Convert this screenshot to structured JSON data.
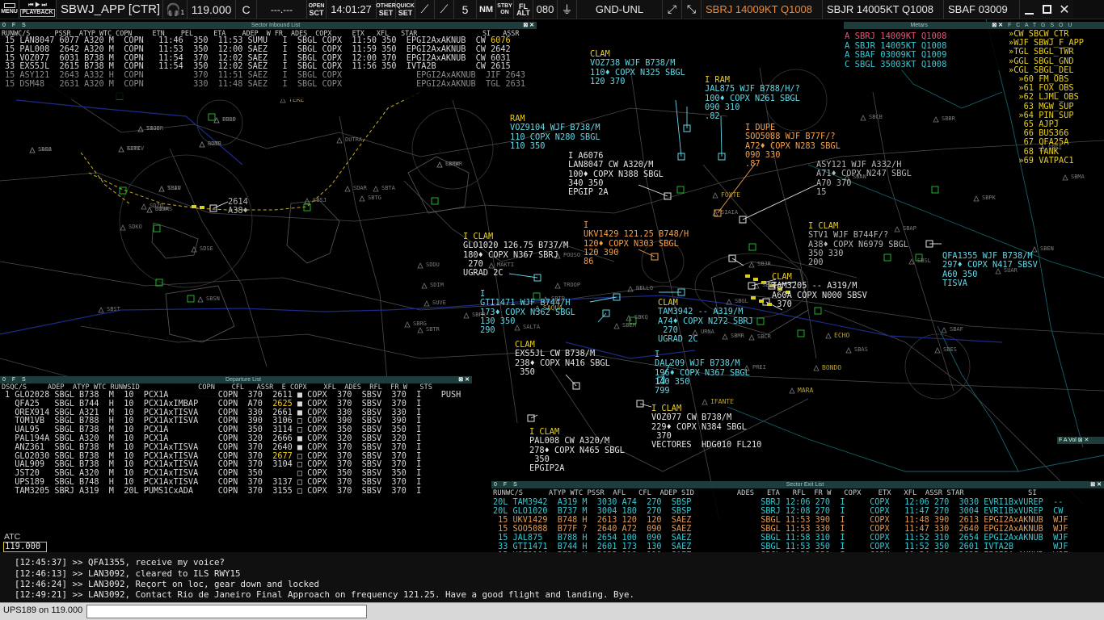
{
  "topbar": {
    "menu": "MENU",
    "playback": "PLAYBACK",
    "station": "SBWJ_APP [CTR]",
    "headset_sub": "1",
    "frequency": "119.000",
    "freq_type": "C",
    "freq_secondary": "---.---",
    "open_l1": "OPEN",
    "open_l2": "SCT",
    "time": "14:01:27",
    "other_l1": "OTHER",
    "other_l2": "SET",
    "quick_l1": "QUICK",
    "quick_l2": "SET",
    "range": "5",
    "range_unit": "NM",
    "stby_l1": "STBY",
    "stby_l2": "ON",
    "fl_l1": "FL",
    "fl_l2": "ALT",
    "trans_alt": "080",
    "alt_filter": "GND-UNL",
    "metar1": "SBRJ 14009KT Q1008",
    "metar2": "SBJR 14005KT Q1008",
    "metar3": "SBAF 03009",
    "color_alert": "#f08a30"
  },
  "inbound": {
    "title": "Sector Inbound List",
    "controls": "0 F S",
    "header": "RUNWC/S      PSSR  ATYP WTC COPN     ETN    PEL     ETA    ADEP  W FR  ADES  COPX     ETX   XFL   STAR                SI   ASSR",
    "rows": [
      {
        "text": "15 LAN8047 6077 A320 M  COPN   11:46  350  11:53 SUMU   I  SBGL COPX  11:50 350  EPGI2AxAKNUB  CW",
        "assr": "6076",
        "cls": "row"
      },
      {
        "text": "15 PAL008  2642 A320 M  COPN   11:53  350  12:00 SAEZ   I  SBGL COPX  11:59 350  EPGI2AxAKNUB  CW",
        "assr": "2642",
        "cls": "row"
      },
      {
        "text": "15 VOZ077  6031 B738 M  COPN   11:54  370  12:02 SAEZ   I  SBGL COPX  12:00 370  EPGI2AxAKNUB  CW",
        "assr": "6031",
        "cls": "row"
      },
      {
        "text": "33 EXS5JL  2615 B738 M  COPN   11:54  350  12:02 SAEZ   I  SBGL COPX  11:56 350  IVTA2B        CW",
        "assr": "2615",
        "cls": "row"
      },
      {
        "text": "15 ASY121  2643 A332 H  COPN          370  11:51 SAEZ   I  SBGL COPX               EPGI2AxAKNUB  JIF",
        "assr": "2643",
        "cls": "row dim"
      },
      {
        "text": "15 DSM48   2631 A320 M  COPN          330  11:48 SAEZ   I  SBGL COPX               EPGI2AxAKNUB  TGL",
        "assr": "2631",
        "cls": "row dim"
      }
    ]
  },
  "metars": {
    "title": "Metars",
    "rows": [
      {
        "text": "A SBRJ 14009KT Q1008",
        "color": "#e8507a"
      },
      {
        "text": "A SBJR 14005KT Q1008",
        "color": "#35c9d4"
      },
      {
        "text": "A SBAF 03009KT Q1009",
        "color": "#35c9d4"
      },
      {
        "text": "C SBGL 35003KT Q1008",
        "color": "#35c9d4"
      }
    ]
  },
  "fcatg": {
    "title": "F C A T G S O U",
    "items": [
      "»CW SBCW_CTR",
      "»WJF SBWJ_F_APP",
      "»TGL SBGL_TWR",
      "»GGL SBGL_GND",
      "»CGL SBGL_DEL",
      "  »60 FM_OBS",
      "  »61 FOX_OBS",
      "  »62 LJML_OBS",
      "   63 MGW_SUP",
      "  »64 PIN_SUP",
      "   65 AJPJ",
      "   66 BUS366",
      "   67 QFA25A",
      "   68 TANK",
      "  »69 VATPAC1"
    ]
  },
  "departure": {
    "title": "Departure List",
    "controls": "0 F S",
    "header": "DSQC/S     ADEP  ATYP WTC RUNWSID              COPN    CFL   ASSR  E COPX    XFL  ADES  RFL  FR W   STS",
    "rows": [
      {
        "pre": "1 GLO2028 SBGL B738  M  10  PCX1A          COPN  370  2611 ",
        "e": "■",
        "post": " COPX  370  SBSV  370  I    PUSH",
        "assr_yellow": false
      },
      {
        "pre": "  QFA25   SBGL B744  H  10  PCX1AxIMBAP    COPN  A70  ",
        "assr": "2625",
        "e": "■",
        "post": " COPX  370  SBSV  370  I",
        "assr_yellow": true
      },
      {
        "pre": "  OREX914 SBGL A321  M  10  PCX1AxTISVA    COPN  330  2661 ",
        "e": "■",
        "post": " COPX  330  SBSV  330  I",
        "assr_yellow": false
      },
      {
        "pre": "  TOM1VB  SBGL B788  H  10  PCX1AxTISVA    COPN  390  3106 ",
        "e": "□",
        "post": " COPX  390  SBSV  390  I",
        "assr_yellow": false
      },
      {
        "pre": "  UAL95   SBGL B738  M  10  PCX1A          COPN  350  3114 ",
        "e": "□",
        "post": " COPX  350  SBSV  350  I",
        "assr_yellow": false
      },
      {
        "pre": "  PAL194A SBGL A320  M  10  PCX1A          COPN  320  2666 ",
        "e": "■",
        "post": " COPX  320  SBSV  320  I",
        "assr_yellow": false
      },
      {
        "pre": "  ANZ361  SBGL B738  M  10  PCX1AxTISVA    COPN  370  2640 ",
        "e": "■",
        "post": " COPX  370  SBSV  370  I",
        "assr_yellow": false
      },
      {
        "pre": "  GLO2030 SBGL B738  M  10  PCX1AxTISVA    COPN  370  ",
        "assr": "2677",
        "e": "□",
        "post": " COPX  370  SBSV  370  I",
        "assr_yellow": true
      },
      {
        "pre": "  UAL909  SBGL B738  M  10  PCX1AxTISVA    COPN  370  3104 ",
        "e": "□",
        "post": " COPX  370  SBSV  370  I",
        "assr_yellow": false
      },
      {
        "pre": "  JST20   SBGL A320  M  10  PCX1AxTISVA    COPN  350       ",
        "e": "□",
        "post": " COPX  350  SBSV  350  I",
        "assr_yellow": false
      },
      {
        "pre": "  UPS189  SBGL B748  H  10  PCX1AxTISVA    COPN  370  3137 ",
        "e": "□",
        "post": " COPX  370  SBSV  370  I",
        "assr_yellow": false
      },
      {
        "pre": "  TAM3205 SBRJ A319  M  20L PUMS1CxADA     COPN  370  3155 ",
        "e": "□",
        "post": " COPX  370  SBSV  370  I",
        "assr_yellow": false
      }
    ]
  },
  "exitlist": {
    "title": "Sector Exit List",
    "controls": "0 F S",
    "header": "RUNWC/S      ATYP WTC PSSR  AFL   CFL  ADEP SID          ADES   ETA   RFL  FR W   COPX    ETX   XFL  ASSR STAR               SI",
    "rows": [
      {
        "text": "20L TAM3942  A319 M  3030 A74  270  SBSP              SBRJ 12:06 270  I     COPX   12:06 270  3030 EVRI1BxVUREP  --",
        "cls": "row cy"
      },
      {
        "text": "20L GLO1020  B737 M  3004 180  270  SBSP              SBRJ 12:08 270  I     COPX   11:47 270  3004 EVRI1BxVUREP  CW",
        "cls": "row cy"
      },
      {
        "text": " 15 UKV1429  B748 H  2613 120  120  SAEZ              SBGL 11:53 390  I     COPX   11:48 390  2613 EPGI2AxAKNUB  WJF",
        "cls": "row or"
      },
      {
        "text": " 15 SOO5088  B77F ?  2640 A72  090  SAEZ              SBGL 11:53 330  I     COPX   11:47 330  2640 EPGI2AxAKNUB  WJF",
        "cls": "row or"
      },
      {
        "text": " 15 JAL875   B788 H  2654 100  090  SAEZ              SBGL 11:58 310  I     COPX   11:52 310  2654 EPGI2AxAKNUB  WJF",
        "cls": "row cy"
      },
      {
        "text": " 33 GTI1471  B744 H  2601 173  130  SAEZ              SBGL 11:53 350  I     COPX   11:52 350  2601 IVTA2B        WJF",
        "cls": "row cy"
      },
      {
        "text": " 15 VOZ9104  B738 M  2635 110  110  SAEZ              SBGL 11:59 350  I     COPX   11:54 350  2635 EPGI2AxAKNUB  WJF",
        "cls": "row cy"
      },
      {
        "text": " 33 VOZ738   B738 M  2647 110  120  SAEZ              SBGL 12:02 370  I     COPX   11:50 370  2647 IVTA2B        WJF",
        "cls": "row cy"
      },
      {
        "text": " 15 DAL209   B738 M  2652 196  140  SAEZ              SBGL 11:56 350  I     COPX   11:53 350  2652 EPGI2AxAKNUB  WJF",
        "cls": "row cy"
      }
    ]
  },
  "vol": {
    "text": "F A Vol"
  },
  "labels": [
    {
      "id": "lbl-voz738",
      "text": "CLAM\nVOZ738 WJF B738/M\n110♦ COPX N325 SBGL\n120 370",
      "color": "cyl",
      "first_yellow": true
    },
    {
      "id": "lbl-jal875",
      "text": "I RAM\nJAL875 WJF B788/H/?\n100♦ COPX N261 SBGL\n090 310\n.82",
      "color": "cyl",
      "first_yellow": true
    },
    {
      "id": "lbl-voz9104",
      "text": "RAM\nVOZ9104 WJF B738/M\n110 COPX N280 SBGL\n110 350",
      "color": "cyl",
      "first_yellow": true
    },
    {
      "id": "lbl-soo5088",
      "text": "I DUPE\nSOO5088 WJF B77F/?\nA72♦ COPX N283 SBGL\n090 330\n.87",
      "color": "orl",
      "first_yellow": false
    },
    {
      "id": "lbl-lan8047",
      "text": "I A6076\nLAN8047 CW A320/M\n100♦ COPX N388 SBGL\n340 350\nEPGIP 2A",
      "color": "wh",
      "first_yellow": false
    },
    {
      "id": "lbl-asy121",
      "text": "ASY121 WJF A332/H\nA71♦ COPX N247 SBGL\nA70 370\n15",
      "color": "grl",
      "first_yellow": false
    },
    {
      "id": "lbl-ukv1429",
      "text": "I\nUKV1429 121.25 B748/H\n120♦ COPX N303 SBGL\n120 390\n86",
      "color": "orl",
      "first_yellow": false
    },
    {
      "id": "lbl-glo1020",
      "text": "I CLAM\nGLO1020 126.75 B737/M\n180♦ COPX N367 SBRJ\n 270\nUGRAD 2C",
      "color": "wh",
      "first_yellow": true
    },
    {
      "id": "lbl-stv1",
      "text": "I CLAM\nSTV1 WJF B744F/?\nA38♦ COPX N6979 SBGL\n350 330\n200",
      "color": "grl",
      "first_yellow": true
    },
    {
      "id": "lbl-qfa1355",
      "text": "QFA1355 WJF B738/M\n297♦ COPX N417 SBSV\nA60 350\nTISVA",
      "color": "cyl",
      "first_yellow": false
    },
    {
      "id": "lbl-gti1471",
      "text": "I\nGTI1471 WJF B744/H\n173♦ COPX N362 SBGL\n130 350\n290",
      "color": "cyl",
      "first_yellow": false
    },
    {
      "id": "lbl-tam3942",
      "text": "CLAM\nTAM3942 -- A319/M\nA74♦ COPX N272 SBRJ\n 270\nUGRAD 2C",
      "color": "cyl",
      "first_yellow": true
    },
    {
      "id": "lbl-tam3205",
      "text": "CLAM\nTAM3205 -- A319/M\nA60A COPX N000 SBSV\n 370",
      "color": "wh",
      "first_yellow": true
    },
    {
      "id": "lbl-exs5jl",
      "text": "CLAM\nEXS5JL CW B738/M\n238♦ COPX N416 SBGL\n 350",
      "color": "wh",
      "first_yellow": true
    },
    {
      "id": "lbl-dal209",
      "text": "I\nDAL209 WJF B738/M\n196♦ COPX N367 SBGL\n140 350\n799",
      "color": "cyl",
      "first_yellow": false
    },
    {
      "id": "lbl-voz077",
      "text": "I CLAM\nVOZ077 CW B738/M\n229♦ COPX N384 SBGL\n 370\nVECTORES  HDG010 FL210",
      "color": "wh",
      "first_yellow": true
    },
    {
      "id": "lbl-pal008",
      "text": "I CLAM\nPAL008 CW A320/M\n278♦ COPX N465 SBGL\n 350\nEPGIP2A",
      "color": "wh",
      "first_yellow": true
    },
    {
      "id": "lbl-sdp",
      "text": "2614\nA38♦",
      "color": "grl",
      "first_yellow": false
    }
  ],
  "fixes": [
    "SBJD",
    "SDCO",
    "SDRK",
    "SBBP",
    "SDTS",
    "SJAV",
    "SDJM",
    "SBGW",
    "SBTA",
    "SBSJ",
    "SDAR",
    "SBTG",
    "SDSE",
    "SBSN",
    "SBST",
    "SDIM",
    "SDDU",
    "SDKO",
    "SBTR",
    "SDZO",
    "SUVE",
    "SBRJ",
    "SBGL",
    "SBJR",
    "SBAF",
    "SBES",
    "SBCB",
    "SBBR",
    "SBMA",
    "SBPK",
    "SBFI",
    "SBAN",
    "SBAP",
    "SBEN",
    "SBSL",
    "SUAR",
    "SBAS",
    "SBKQ",
    "SBEM",
    "SBMR",
    "SBCR",
    "SBPR",
    "SBTP",
    "SBRG",
    "SAQUA",
    "PREI",
    "MARA",
    "ECHO",
    "BONDO",
    "IFANTE",
    "FOXTE",
    "SIAIA",
    "TERE",
    "DUTRA",
    "POUSO",
    "MAKTI",
    "SALTA",
    "TROOP",
    "NELLO",
    "URNA",
    "TIGER",
    "SANA",
    "KETIV",
    "POLO",
    "ROMB",
    "TRIO",
    "DIMAS",
    "CAMAR"
  ],
  "chat": {
    "atc_label": "ATC",
    "atc_freq": "119.000",
    "messages": [
      "[12:45:37] >> QFA1355, receive my voice?",
      "[12:46:13] >> LAN3092, cleared to ILS RWY15",
      "[12:46:24] >> LAN3092, Reçort on loc, gear down and locked",
      "[12:49:21] >> LAN3092, Contact Rio de Janeiro Final Approach on frequency 121.25. Have a good flight and landing. Bye."
    ]
  },
  "command": {
    "prefix": "UPS189 on 119.000",
    "value": ""
  }
}
